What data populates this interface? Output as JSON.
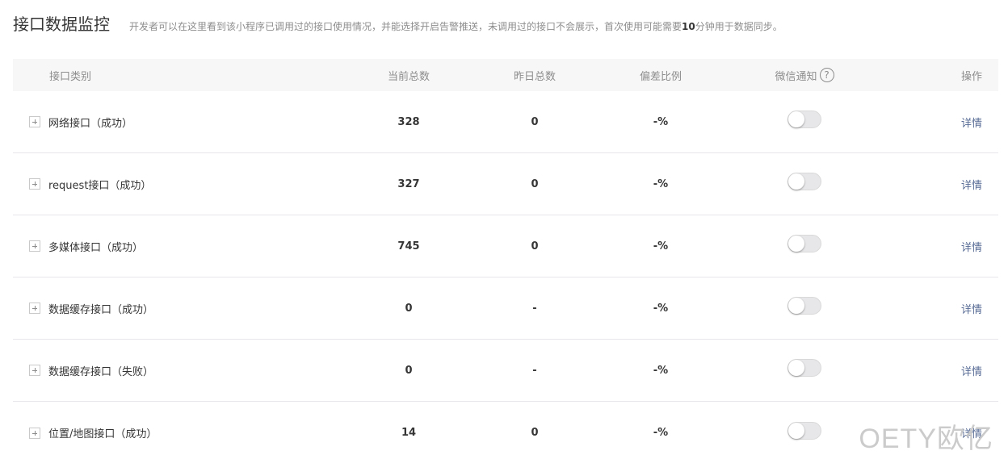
{
  "header": {
    "title": "接口数据监控",
    "description_before": "开发者可以在这里看到该小程序已调用过的接口使用情况，并能选择开启告警推送，未调用过的接口不会展示，首次使用可能需要",
    "description_bold": "10",
    "description_after": "分钟用于数据同步。"
  },
  "table": {
    "columns": {
      "name": "接口类别",
      "current": "当前总数",
      "yesterday": "昨日总数",
      "ratio": "偏差比例",
      "notify": "微信通知",
      "action": "操作"
    },
    "help_glyph": "?",
    "rows": [
      {
        "name": "网络接口（成功）",
        "current": "328",
        "yesterday": "0",
        "ratio": "-%",
        "notify": false,
        "action": "详情"
      },
      {
        "name": "request接口（成功）",
        "current": "327",
        "yesterday": "0",
        "ratio": "-%",
        "notify": false,
        "action": "详情"
      },
      {
        "name": "多媒体接口（成功）",
        "current": "745",
        "yesterday": "0",
        "ratio": "-%",
        "notify": false,
        "action": "详情"
      },
      {
        "name": "数据缓存接口（成功）",
        "current": "0",
        "yesterday": "-",
        "ratio": "-%",
        "notify": false,
        "action": "详情"
      },
      {
        "name": "数据缓存接口（失败）",
        "current": "0",
        "yesterday": "-",
        "ratio": "-%",
        "notify": false,
        "action": "详情"
      },
      {
        "name": "位置/地图接口（成功）",
        "current": "14",
        "yesterday": "0",
        "ratio": "-%",
        "notify": false,
        "action": "详情"
      }
    ]
  },
  "watermark": "OETY欧亿",
  "colors": {
    "link": "#576b95",
    "header_bg": "#f7f7f8",
    "toggle_off": "#e7e7e9"
  }
}
